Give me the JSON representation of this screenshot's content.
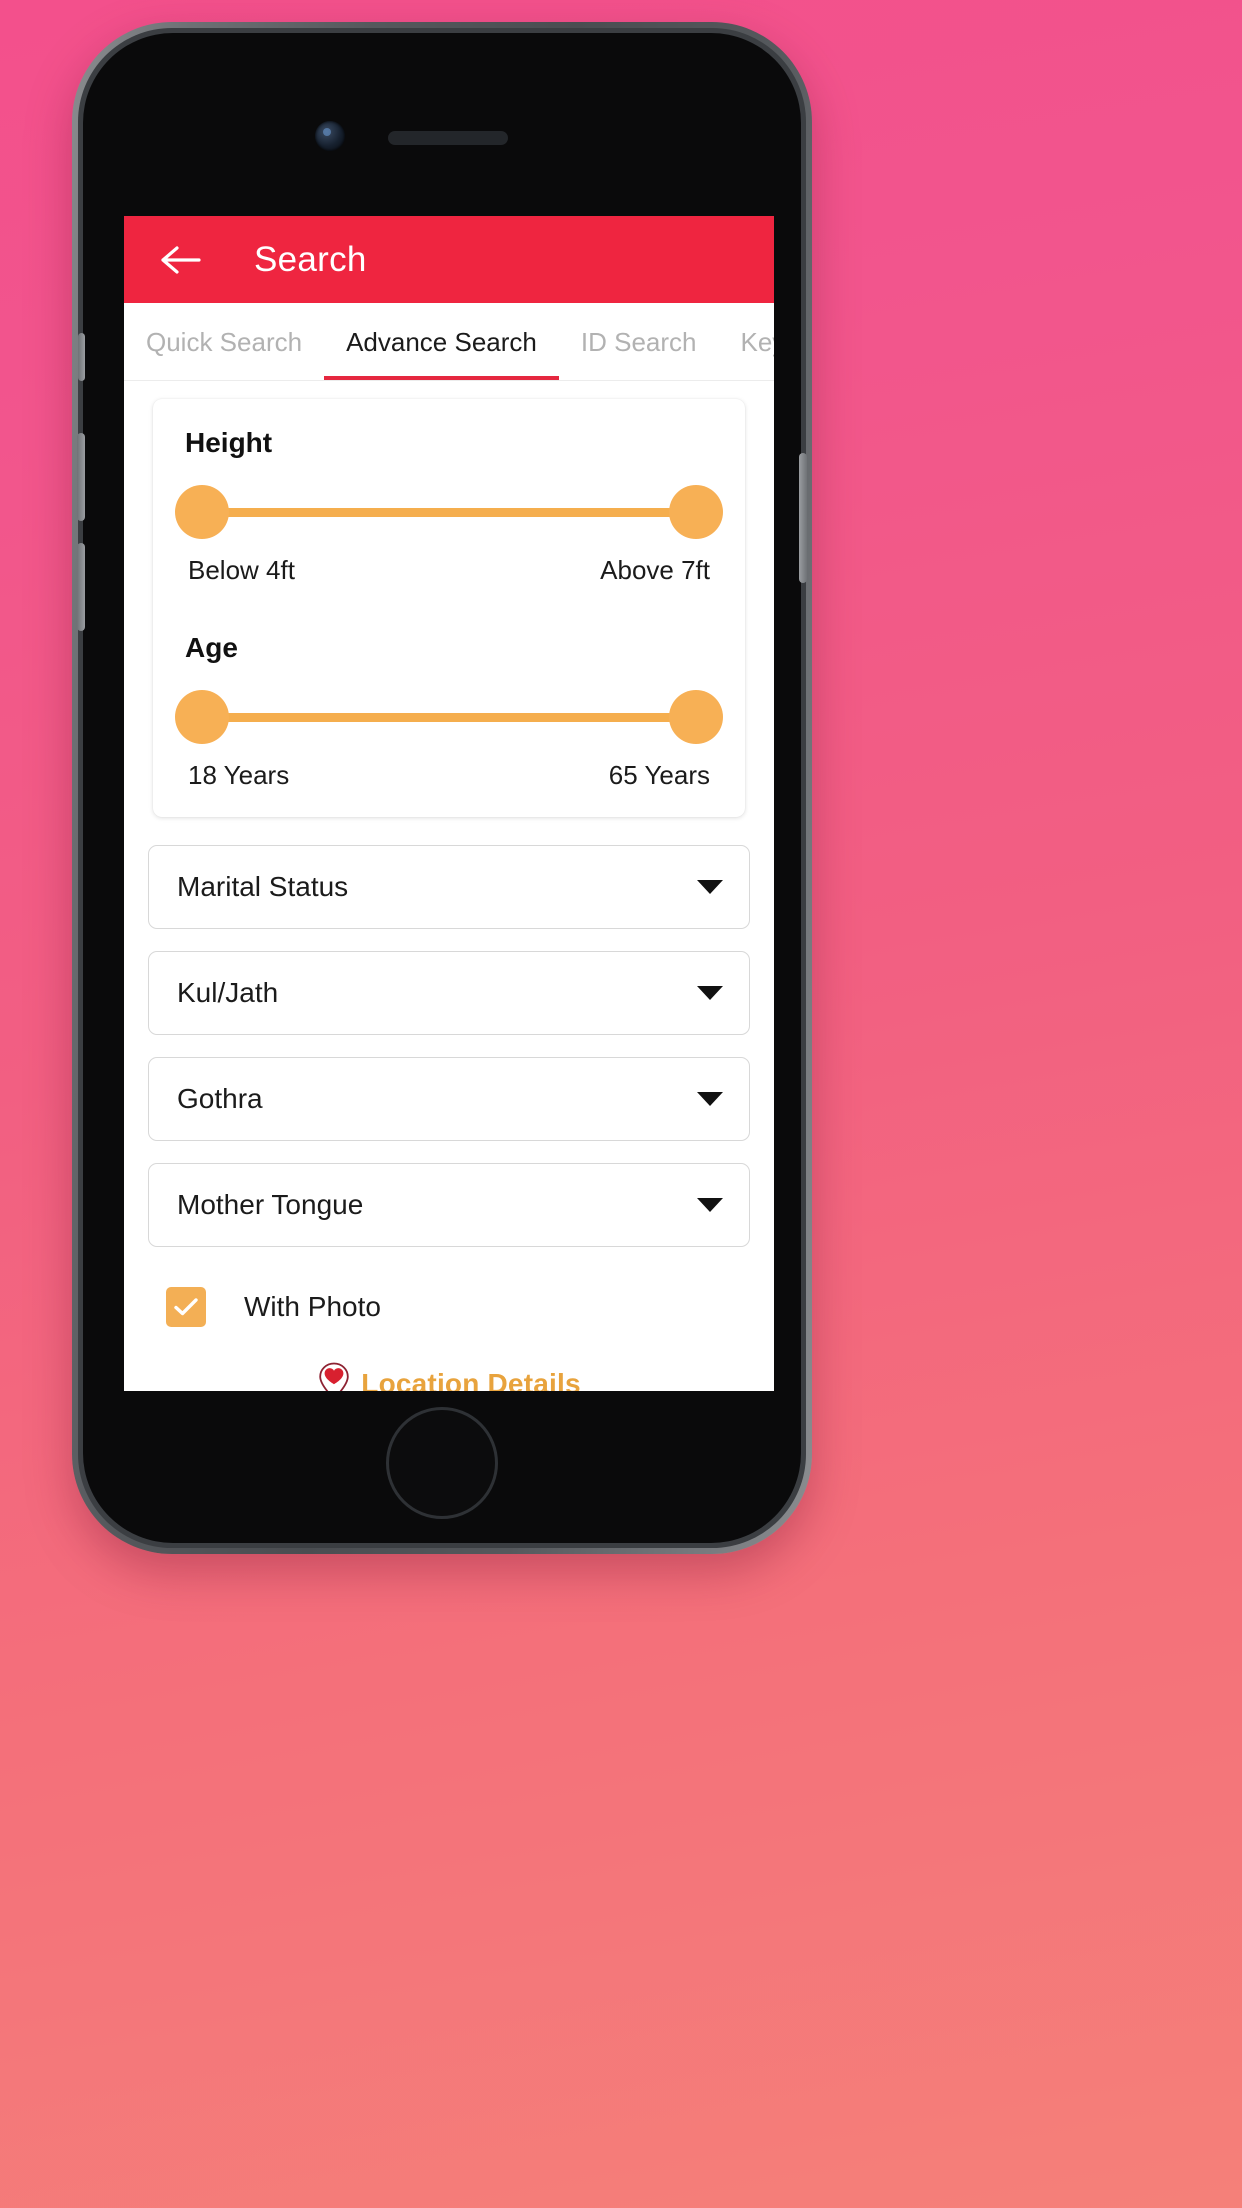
{
  "app": {
    "header": {
      "title": "Search",
      "back_icon": "arrow-left-icon",
      "background_color": "#ef2540"
    },
    "tabs": [
      {
        "label": "Quick Search",
        "active": false
      },
      {
        "label": "Advance Search",
        "active": true
      },
      {
        "label": "ID Search",
        "active": false
      },
      {
        "label": "Keyw",
        "active": false
      }
    ],
    "filters": {
      "sliders": [
        {
          "title": "Height",
          "min_label": "Below 4ft",
          "max_label": "Above 7ft",
          "left_value": 0,
          "right_value": 100
        },
        {
          "title": "Age",
          "min_label": "18 Years",
          "max_label": "65 Years",
          "left_value": 0,
          "right_value": 100
        }
      ],
      "dropdowns": [
        {
          "label": "Marital Status",
          "icon": "chevron-down-icon"
        },
        {
          "label": "Kul/Jath",
          "icon": "chevron-down-icon"
        },
        {
          "label": "Gothra",
          "icon": "chevron-down-icon"
        },
        {
          "label": "Mother Tongue",
          "icon": "chevron-down-icon"
        }
      ],
      "checkbox": {
        "label": "With Photo",
        "checked": true,
        "color": "#f3af55"
      },
      "location_link": {
        "label": "Location Details",
        "icon": "map-pin-heart-icon",
        "color": "#e8a33d"
      }
    },
    "theme": {
      "accent_red": "#ef2540",
      "accent_orange": "#f5ae4e",
      "tab_indicator": "#e5273f",
      "inactive_tab_text": "#b2b2b2"
    }
  }
}
